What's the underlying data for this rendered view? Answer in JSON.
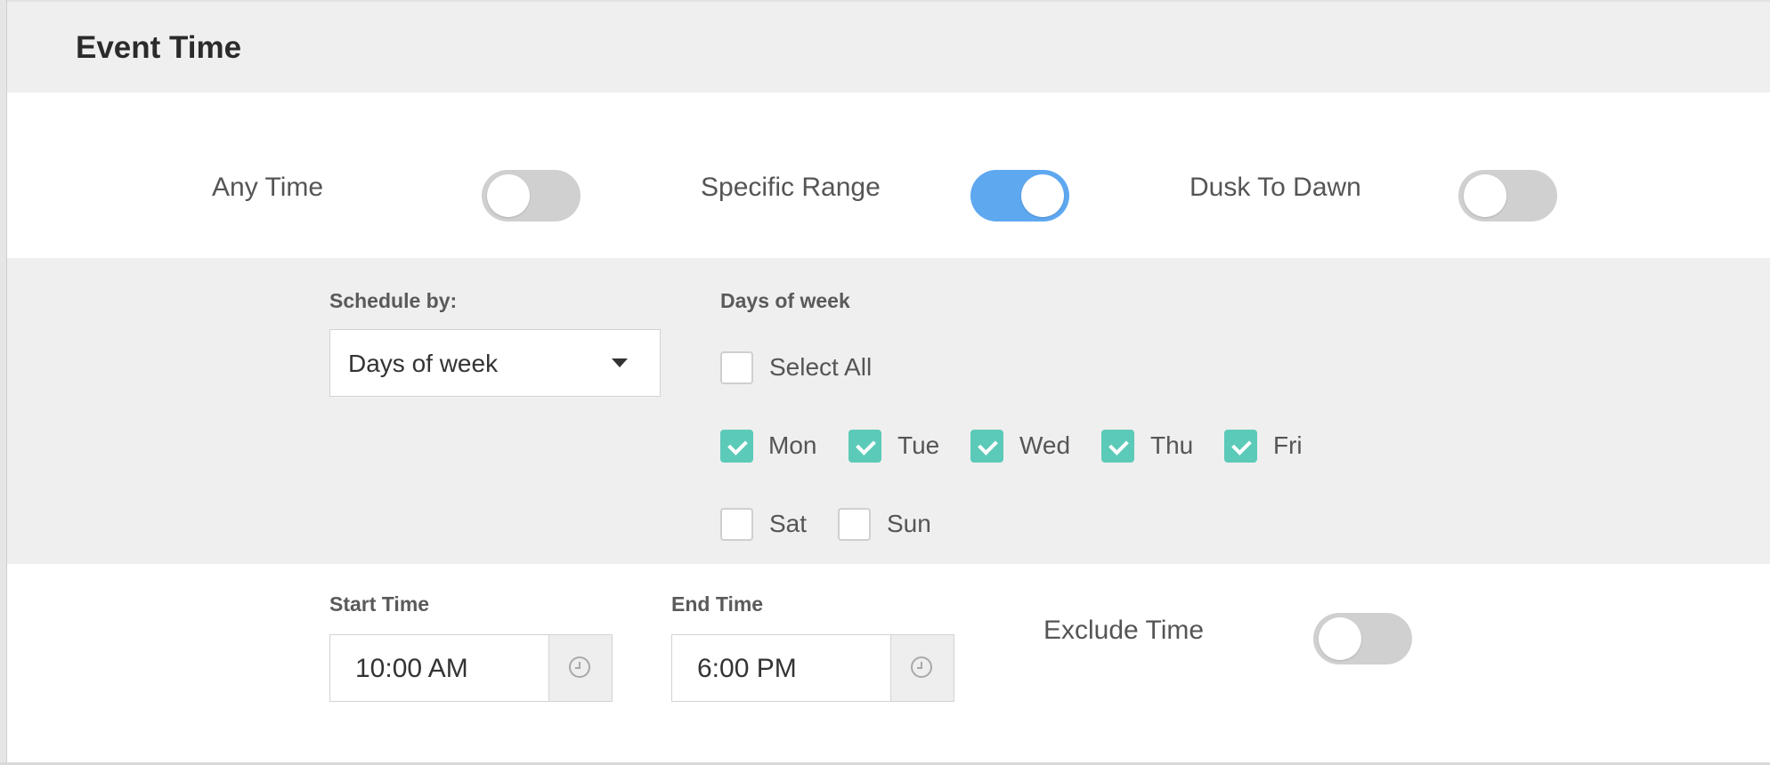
{
  "header": {
    "title": "Event Time"
  },
  "modes": [
    {
      "label": "Any Time",
      "on": false
    },
    {
      "label": "Specific Range",
      "on": true
    },
    {
      "label": "Dusk To Dawn",
      "on": false
    }
  ],
  "schedule": {
    "schedule_by_label": "Schedule by:",
    "schedule_by_value": "Days of week",
    "days_label": "Days of week",
    "select_all_label": "Select All",
    "select_all_checked": false,
    "days": [
      {
        "label": "Mon",
        "checked": true
      },
      {
        "label": "Tue",
        "checked": true
      },
      {
        "label": "Wed",
        "checked": true
      },
      {
        "label": "Thu",
        "checked": true
      },
      {
        "label": "Fri",
        "checked": true
      },
      {
        "label": "Sat",
        "checked": false
      },
      {
        "label": "Sun",
        "checked": false
      }
    ]
  },
  "time": {
    "start_label": "Start Time",
    "start_value": "10:00 AM",
    "end_label": "End Time",
    "end_value": "6:00 PM",
    "exclude_label": "Exclude Time",
    "exclude_on": false
  },
  "colors": {
    "toggle_on": "#5ea8f0",
    "toggle_off": "#d0d0d0",
    "checkbox_checked": "#5ccab8",
    "panel_bg": "#efefef"
  }
}
